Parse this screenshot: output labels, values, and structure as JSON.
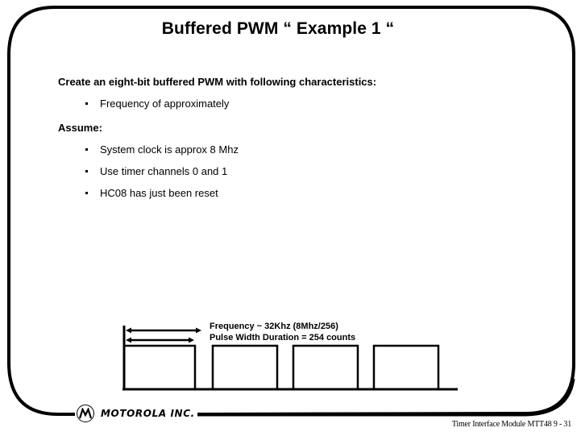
{
  "slide": {
    "title": "Buffered PWM “ Example 1 “",
    "intro_heading": "Create an eight-bit buffered PWM with following characteristics:",
    "characteristics": [
      "Frequency of approximately"
    ],
    "assume_heading": "Assume:",
    "assumptions": [
      "System clock is approx 8 Mhz",
      "Use timer channels 0 and 1",
      "HC08 has just been reset"
    ]
  },
  "diagram": {
    "frequency_label": "Frequency  ~  32Khz  (8Mhz/256)",
    "pulse_width_label": "Pulse Width Duration = 254 counts",
    "pulse_count": 4,
    "period_counts": 256,
    "pulse_width_counts": 254
  },
  "branding": {
    "logo_text": "MOTOROLA INC.",
    "logo_icon": "motorola-batwing-icon"
  },
  "footer": {
    "text": "Timer Interface Module MTT48  9 - 31"
  }
}
